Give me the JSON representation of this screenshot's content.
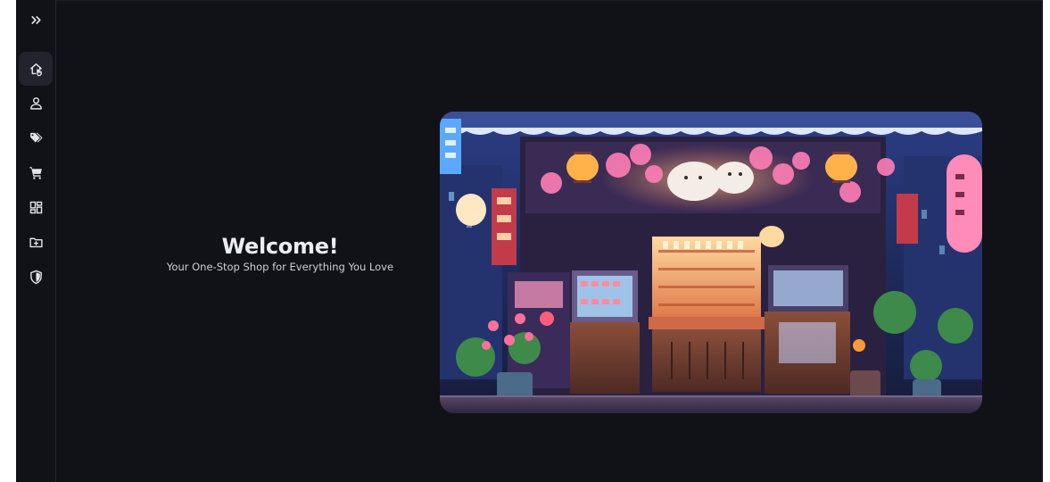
{
  "sidebar": {
    "toggle": {
      "icon": "chevrons-right-icon"
    },
    "items": [
      {
        "id": "home",
        "icon": "home-icon",
        "active": true
      },
      {
        "id": "user",
        "icon": "user-icon",
        "active": false
      },
      {
        "id": "tags",
        "icon": "tag-icon",
        "active": false
      },
      {
        "id": "cart",
        "icon": "cart-icon",
        "active": false
      },
      {
        "id": "dashboard",
        "icon": "grid-icon",
        "active": false
      },
      {
        "id": "folder",
        "icon": "folder-plus-icon",
        "active": false
      },
      {
        "id": "security",
        "icon": "shield-icon",
        "active": false
      }
    ]
  },
  "hero": {
    "title": "Welcome!",
    "subtitle": "Your One-Stop Shop for Everything You Love"
  },
  "colors": {
    "background": "#111118",
    "sidebar_active": "#23232d",
    "icon": "#e4e4ea",
    "title": "#ececf1"
  }
}
